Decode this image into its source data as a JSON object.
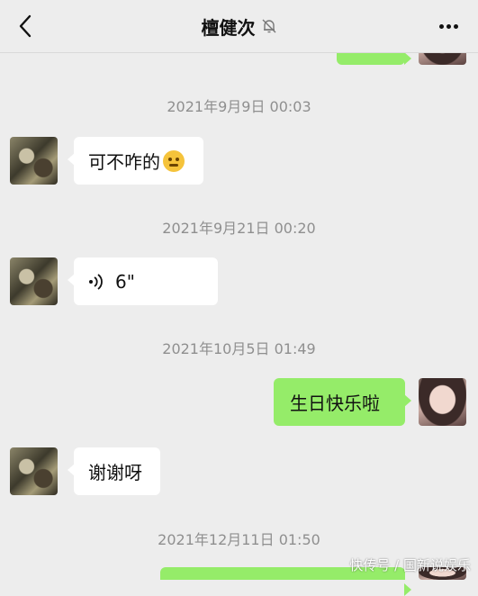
{
  "header": {
    "title": "檀健次",
    "mute_icon": "bell-muted-icon",
    "back_icon": "chevron-left-icon",
    "more_icon": "more-dots-icon"
  },
  "timestamps": [
    "2021年9月9日 00:03",
    "2021年9月21日 00:20",
    "2021年10月5日 01:49",
    "2021年12月11日 01:50"
  ],
  "messages": [
    {
      "from": "other",
      "text": "可不咋的",
      "emoji": "thinking-face-emoji"
    },
    {
      "from": "other",
      "type": "voice",
      "duration": "6\""
    },
    {
      "from": "self",
      "text": "生日快乐啦"
    },
    {
      "from": "other",
      "text": "谢谢呀"
    }
  ],
  "colors": {
    "background": "#ededed",
    "self_bubble": "#95ec69",
    "other_bubble": "#ffffff",
    "timestamp": "#8f8f8f"
  },
  "watermark": "快传号 / 国新说娱乐"
}
